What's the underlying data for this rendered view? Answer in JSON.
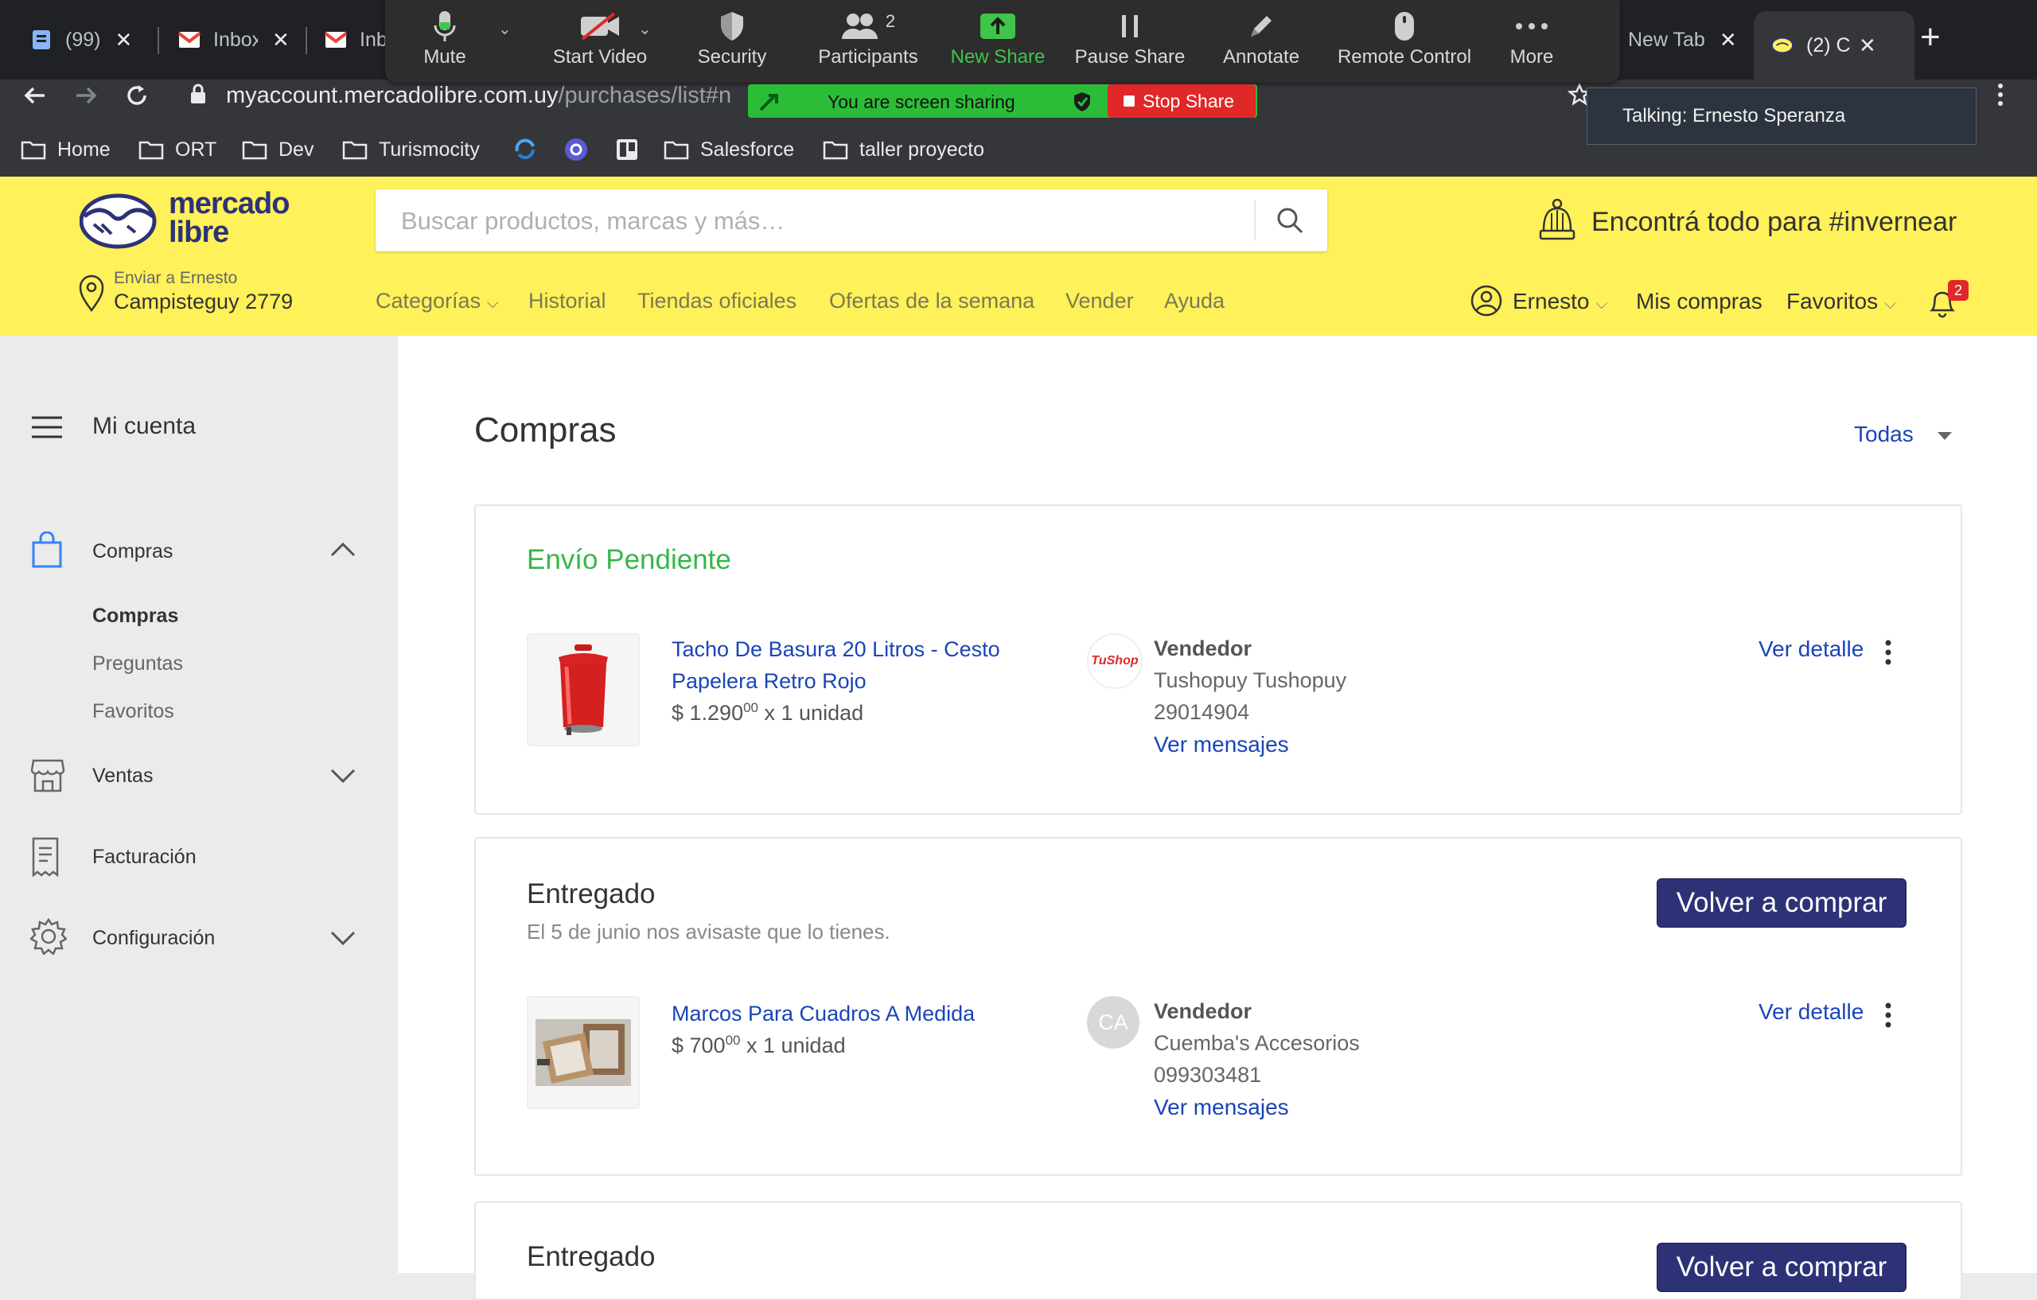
{
  "browser": {
    "tabs": [
      {
        "label": "(99)"
      },
      {
        "label": "Inbox"
      },
      {
        "label": "Inb"
      },
      {
        "label": "New Tab"
      },
      {
        "label": "(2) C"
      }
    ],
    "url_host": "myaccount.mercadolibre.com.uy",
    "url_path": "/purchases/list#n",
    "bookmarks": [
      "Home",
      "ORT",
      "Dev",
      "Turismocity",
      "Salesforce",
      "taller proyecto"
    ]
  },
  "zoom": {
    "buttons": [
      "Mute",
      "Start Video",
      "Security",
      "Participants",
      "New Share",
      "Pause Share",
      "Annotate",
      "Remote Control",
      "More"
    ],
    "participants_count": "2",
    "sharing_text": "You are screen sharing",
    "stop_share": "Stop Share",
    "talking": "Talking: Ernesto Speranza",
    "accent_green": "#2bbd37",
    "stop_red": "#e02828"
  },
  "ml": {
    "logo_top": "mercado",
    "logo_bottom": "libre",
    "search_placeholder": "Buscar productos, marcas y más…",
    "promo": "Encontrá todo para #invernear",
    "ship_to_label": "Enviar a Ernesto",
    "ship_to_address": "Campisteguy 2779",
    "nav": [
      "Categorías",
      "Historial",
      "Tiendas oficiales",
      "Ofertas de la semana",
      "Vender",
      "Ayuda"
    ],
    "user": "Ernesto",
    "my_purchases": "Mis compras",
    "favorites": "Favoritos",
    "notifications": "2",
    "brand_yellow": "#fff159"
  },
  "sidebar": {
    "title": "Mi cuenta",
    "sections": [
      "Compras",
      "Ventas",
      "Facturación",
      "Configuración"
    ],
    "compras_sub": [
      "Compras",
      "Preguntas",
      "Favoritos"
    ]
  },
  "main": {
    "title": "Compras",
    "filter": "Todas",
    "orders": [
      {
        "status": "Envío Pendiente",
        "status_color": "#39b54a",
        "product_line1": "Tacho De Basura 20 Litros - Cesto",
        "product_line2": "Papelera Retro Rojo",
        "price_int": "$ 1.290",
        "price_cents": "00",
        "qty": " x 1 unidad",
        "seller_label": "Vendedor",
        "seller_name": "Tushopuy Tushopuy",
        "seller_phone": "29014904",
        "messages_link": "Ver mensajes",
        "detail_link": "Ver detalle",
        "seller_logo_text": "TuShop"
      },
      {
        "status": "Entregado",
        "subtitle": "El 5 de junio nos avisaste que lo tienes.",
        "buy_again": "Volver a comprar",
        "product_line1": "Marcos Para Cuadros A Medida",
        "price_int": "$ 700",
        "price_cents": "00",
        "qty": " x 1 unidad",
        "seller_label": "Vendedor",
        "seller_name": "Cuemba's Accesorios",
        "seller_phone": "099303481",
        "messages_link": "Ver mensajes",
        "detail_link": "Ver detalle",
        "seller_initials": "CA"
      },
      {
        "status": "Entregado",
        "buy_again": "Volver a comprar"
      }
    ]
  }
}
